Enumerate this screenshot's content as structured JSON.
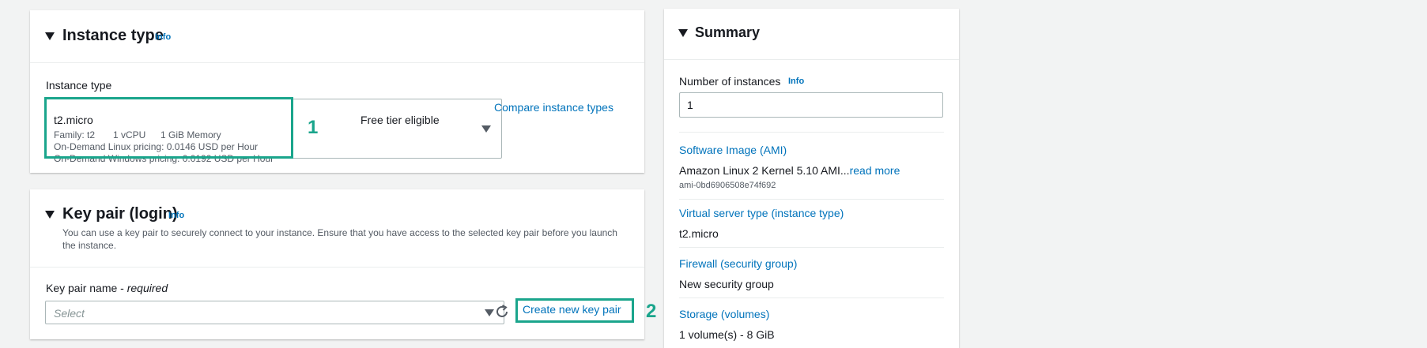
{
  "instance_type_panel": {
    "title": "Instance type",
    "info_label": "Info",
    "field_label": "Instance type",
    "selected": {
      "name": "t2.micro",
      "family": "Family: t2",
      "vcpu": "1 vCPU",
      "memory": "1 GiB Memory",
      "linux_pricing": "On-Demand Linux pricing: 0.0146 USD per Hour",
      "windows_pricing": "On-Demand Windows pricing: 0.0192 USD per Hour",
      "badge": "Free tier eligible"
    },
    "compare_link": "Compare instance types",
    "step_marker": "1"
  },
  "key_pair_panel": {
    "title": "Key pair (login)",
    "info_label": "Info",
    "description": "You can use a key pair to securely connect to your instance. Ensure that you have access to the selected key pair before you launch the instance.",
    "field_label": "Key pair name",
    "field_required": "required",
    "select_placeholder": "Select",
    "create_link": "Create new key pair",
    "step_marker": "2"
  },
  "summary_panel": {
    "title": "Summary",
    "instances_label": "Number of instances",
    "info_label": "Info",
    "instances_value": "1",
    "software_image_link": "Software Image (AMI)",
    "ami_name": "Amazon Linux 2 Kernel 5.10 AMI...",
    "read_more": "read more",
    "ami_id": "ami-0bd6906508e74f692",
    "server_type_link": "Virtual server type (instance type)",
    "server_type_value": "t2.micro",
    "firewall_link": "Firewall (security group)",
    "firewall_value": "New security group",
    "storage_link": "Storage (volumes)",
    "storage_value": "1 volume(s) - 8 GiB"
  },
  "colors": {
    "link": "#0073bb",
    "highlight": "#1aa58c",
    "text": "#16191f"
  }
}
